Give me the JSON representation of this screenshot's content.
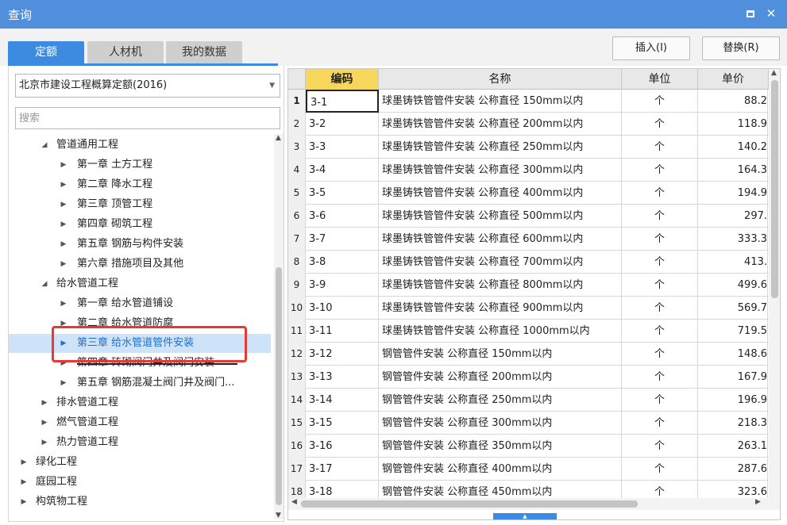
{
  "window": {
    "title": "查询",
    "restore_icon": "restore-icon",
    "close_icon": "✕"
  },
  "tabs": [
    {
      "label": "定额",
      "active": true
    },
    {
      "label": "人材机",
      "active": false
    },
    {
      "label": "我的数据",
      "active": false
    }
  ],
  "actions": {
    "insert": "插入(I)",
    "replace": "替换(R)"
  },
  "left": {
    "quota_select": "北京市建设工程概算定额(2016)",
    "search_placeholder": "搜索",
    "tree": [
      {
        "label": "管道通用工程",
        "arrow": "◢"
      },
      {
        "label": "第一章 土方工程",
        "arrow": "▶"
      },
      {
        "label": "第二章 降水工程",
        "arrow": "▶"
      },
      {
        "label": "第三章 顶管工程",
        "arrow": "▶"
      },
      {
        "label": "第四章 砌筑工程",
        "arrow": "▶"
      },
      {
        "label": "第五章 钢筋与构件安装",
        "arrow": "▶"
      },
      {
        "label": "第六章 措施项目及其他",
        "arrow": "▶"
      },
      {
        "label": "给水管道工程",
        "arrow": "◢"
      },
      {
        "label": "第一章 给水管道铺设",
        "arrow": "▶"
      },
      {
        "label": "第二章 给水管道防腐",
        "arrow": "▶"
      },
      {
        "label": "第三章 给水管道管件安装",
        "arrow": "▶"
      },
      {
        "label": "第四章 砖砌阀门井及阀门安装",
        "arrow": "▶"
      },
      {
        "label": "第五章 钢筋混凝土阀门井及阀门...",
        "arrow": "▶"
      },
      {
        "label": "排水管道工程",
        "arrow": "▶"
      },
      {
        "label": "燃气管道工程",
        "arrow": "▶"
      },
      {
        "label": "热力管道工程",
        "arrow": "▶"
      },
      {
        "label": "绿化工程",
        "arrow": "▶"
      },
      {
        "label": "庭园工程",
        "arrow": "▶"
      },
      {
        "label": "构筑物工程",
        "arrow": "▶"
      }
    ]
  },
  "grid": {
    "headers": {
      "code": "编码",
      "name": "名称",
      "unit": "单位",
      "price": "单价"
    },
    "rows": [
      {
        "no": "1",
        "code": "3-1",
        "name": "球墨铸铁管管件安装 公称直径 150mm以内",
        "unit": "个",
        "price": "88.2"
      },
      {
        "no": "2",
        "code": "3-2",
        "name": "球墨铸铁管管件安装 公称直径 200mm以内",
        "unit": "个",
        "price": "118.9"
      },
      {
        "no": "3",
        "code": "3-3",
        "name": "球墨铸铁管管件安装 公称直径 250mm以内",
        "unit": "个",
        "price": "140.2"
      },
      {
        "no": "4",
        "code": "3-4",
        "name": "球墨铸铁管管件安装 公称直径 300mm以内",
        "unit": "个",
        "price": "164.3"
      },
      {
        "no": "5",
        "code": "3-5",
        "name": "球墨铸铁管管件安装 公称直径 400mm以内",
        "unit": "个",
        "price": "194.9"
      },
      {
        "no": "6",
        "code": "3-6",
        "name": "球墨铸铁管管件安装 公称直径 500mm以内",
        "unit": "个",
        "price": "297."
      },
      {
        "no": "7",
        "code": "3-7",
        "name": "球墨铸铁管管件安装 公称直径 600mm以内",
        "unit": "个",
        "price": "333.3"
      },
      {
        "no": "8",
        "code": "3-8",
        "name": "球墨铸铁管管件安装 公称直径 700mm以内",
        "unit": "个",
        "price": "413."
      },
      {
        "no": "9",
        "code": "3-9",
        "name": "球墨铸铁管管件安装 公称直径 800mm以内",
        "unit": "个",
        "price": "499.6"
      },
      {
        "no": "10",
        "code": "3-10",
        "name": "球墨铸铁管管件安装 公称直径 900mm以内",
        "unit": "个",
        "price": "569.7"
      },
      {
        "no": "11",
        "code": "3-11",
        "name": "球墨铸铁管管件安装 公称直径 1000mm以内",
        "unit": "个",
        "price": "719.5"
      },
      {
        "no": "12",
        "code": "3-12",
        "name": "钢管管件安装 公称直径 150mm以内",
        "unit": "个",
        "price": "148.6"
      },
      {
        "no": "13",
        "code": "3-13",
        "name": "钢管管件安装 公称直径 200mm以内",
        "unit": "个",
        "price": "167.9"
      },
      {
        "no": "14",
        "code": "3-14",
        "name": "钢管管件安装 公称直径 250mm以内",
        "unit": "个",
        "price": "196.9"
      },
      {
        "no": "15",
        "code": "3-15",
        "name": "钢管管件安装 公称直径 300mm以内",
        "unit": "个",
        "price": "218.3"
      },
      {
        "no": "16",
        "code": "3-16",
        "name": "钢管管件安装 公称直径 350mm以内",
        "unit": "个",
        "price": "263.1"
      },
      {
        "no": "17",
        "code": "3-17",
        "name": "钢管管件安装 公称直径 400mm以内",
        "unit": "个",
        "price": "287.6"
      },
      {
        "no": "18",
        "code": "3-18",
        "name": "钢管管件安装 公称直径 450mm以内",
        "unit": "个",
        "price": "323.6"
      }
    ]
  },
  "colors": {
    "titlebar": "#4f8fdc",
    "tab_active": "#3c8be0",
    "highlight": "#e53935",
    "code_header": "#f6d65b",
    "selected_row": "#cfe3f8"
  }
}
